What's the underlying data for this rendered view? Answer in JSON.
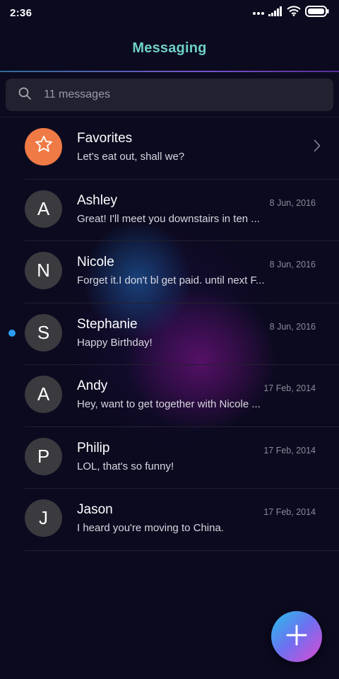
{
  "status_bar": {
    "time": "2:36",
    "icons": [
      "more-dots-icon",
      "signal-icon",
      "wifi-icon",
      "battery-icon"
    ]
  },
  "header": {
    "title": "Messaging"
  },
  "search": {
    "placeholder": "11 messages",
    "icon": "search-icon"
  },
  "favorites": {
    "name": "Favorites",
    "preview": "Let's eat out, shall we?",
    "icon": "star-icon",
    "color": "#f07a45"
  },
  "conversations": [
    {
      "initial": "A",
      "name": "Ashley",
      "preview": "Great! I'll meet you downstairs in ten ...",
      "date": "8 Jun, 2016",
      "unread": false
    },
    {
      "initial": "N",
      "name": "Nicole",
      "preview": "Forget it.I don't bl get paid. until next F...",
      "date": "8 Jun, 2016",
      "unread": false
    },
    {
      "initial": "S",
      "name": "Stephanie",
      "preview": "Happy Birthday!",
      "date": "8 Jun, 2016",
      "unread": true
    },
    {
      "initial": "A",
      "name": "Andy",
      "preview": "Hey, want to get together with Nicole ...",
      "date": "17 Feb, 2014",
      "unread": false
    },
    {
      "initial": "P",
      "name": "Philip",
      "preview": "LOL, that's so funny!",
      "date": "17 Feb, 2014",
      "unread": false
    },
    {
      "initial": "J",
      "name": "Jason",
      "preview": "I heard you're moving to China.",
      "date": "17 Feb, 2014",
      "unread": false
    }
  ],
  "fab": {
    "icon": "plus-icon"
  },
  "colors": {
    "accent_title": "#6fd0c8",
    "unread_dot": "#2b9cf2",
    "background": "#0b0a1f"
  }
}
